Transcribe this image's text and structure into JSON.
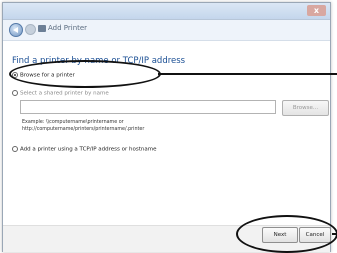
{
  "window": {
    "title": "Add Printer",
    "close_label": "x"
  },
  "main": {
    "heading": "Find a printer by name or TCP/IP address",
    "options": {
      "browse": "Browse for a printer",
      "shared": "Select a shared printer by name",
      "tcp": "Add a printer using a TCP/IP address or hostname"
    },
    "shared_input_value": "",
    "browse_button_label": "Browse...",
    "example_lines": [
      "Example: \\\\computername\\printername or",
      "http://computername/printers/printername/.printer"
    ]
  },
  "footer": {
    "next_label": "Next",
    "cancel_label": "Cancel"
  },
  "icons": {
    "back": "back-arrow-icon",
    "forward": "forward-arrow-icon",
    "printer": "printer-icon"
  },
  "colors": {
    "heading": "#1b4f94",
    "callout": "#111111"
  }
}
